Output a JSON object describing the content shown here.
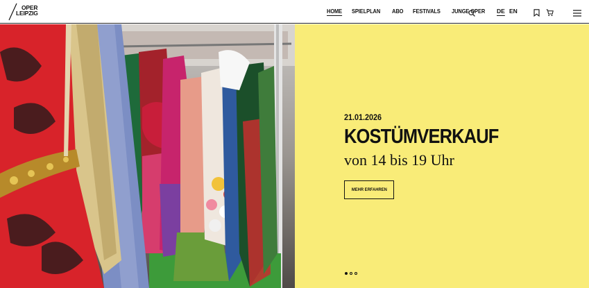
{
  "logo": {
    "line1": "OPER",
    "line2": "LEIPZIG"
  },
  "nav": [
    {
      "label": "HOME",
      "active": true
    },
    {
      "label": "SPIELPLAN"
    },
    {
      "label": "ABO"
    },
    {
      "label": "FESTIVALS"
    },
    {
      "label": "JUNGE OPER"
    }
  ],
  "languages": {
    "de": "DE",
    "en": "EN"
  },
  "icons": {
    "search": "search-icon",
    "bookmark": "bookmark-icon",
    "cart": "cart-icon",
    "menu": "hamburger-menu-icon"
  },
  "hero": {
    "date": "21.01.2026",
    "title": "KOSTÜMVERKAUF",
    "subtitle": "von 14 bis 19 Uhr",
    "button": "MEHR ERFAHREN",
    "panel_color": "#f9ec78"
  },
  "slider": {
    "count": 3,
    "active": 1
  }
}
